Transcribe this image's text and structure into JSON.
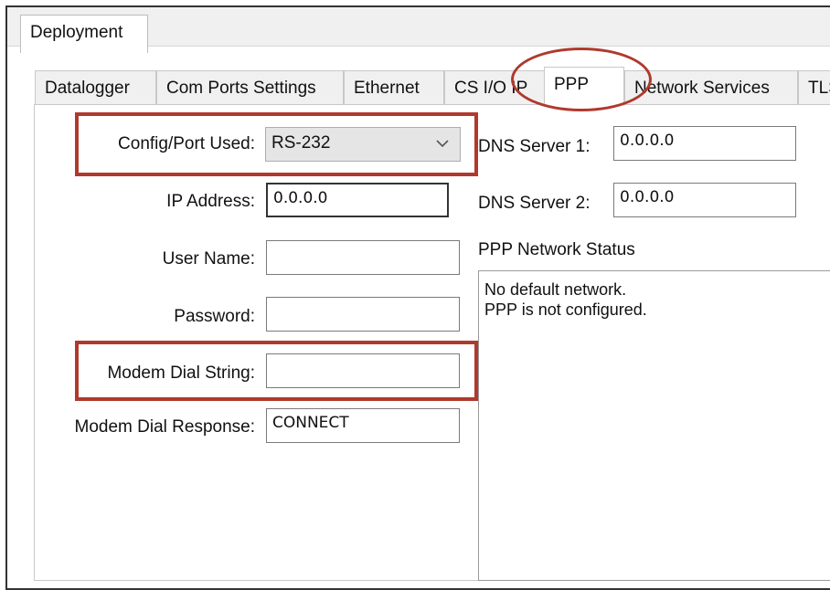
{
  "top_tab": "Deployment",
  "tabs": [
    {
      "label": "Datalogger"
    },
    {
      "label": "Com Ports Settings"
    },
    {
      "label": "Ethernet"
    },
    {
      "label": "CS I/O IP"
    },
    {
      "label": "PPP"
    },
    {
      "label": "Network Services"
    },
    {
      "label": "TLS"
    }
  ],
  "active_tab": "PPP",
  "form": {
    "config_port": {
      "label": "Config/Port Used:",
      "value": "RS-232"
    },
    "ip_address": {
      "label": "IP Address:",
      "value": "0.0.0.0"
    },
    "user_name": {
      "label": "User Name:",
      "value": ""
    },
    "password": {
      "label": "Password:",
      "value": ""
    },
    "modem_dial_string": {
      "label": "Modem Dial String:",
      "value": ""
    },
    "modem_dial_response": {
      "label": "Modem Dial Response:",
      "value": "CONNECT"
    },
    "dns1": {
      "label": "DNS Server 1:",
      "value": "0.0.0.0"
    },
    "dns2": {
      "label": "DNS Server 2:",
      "value": "0.0.0.0"
    }
  },
  "status": {
    "title": "PPP Network Status",
    "lines": [
      "No default network.",
      "PPP is not configured."
    ]
  },
  "highlight_color": "#b0392d",
  "icons": {
    "dropdown": "chevron-down-icon"
  }
}
